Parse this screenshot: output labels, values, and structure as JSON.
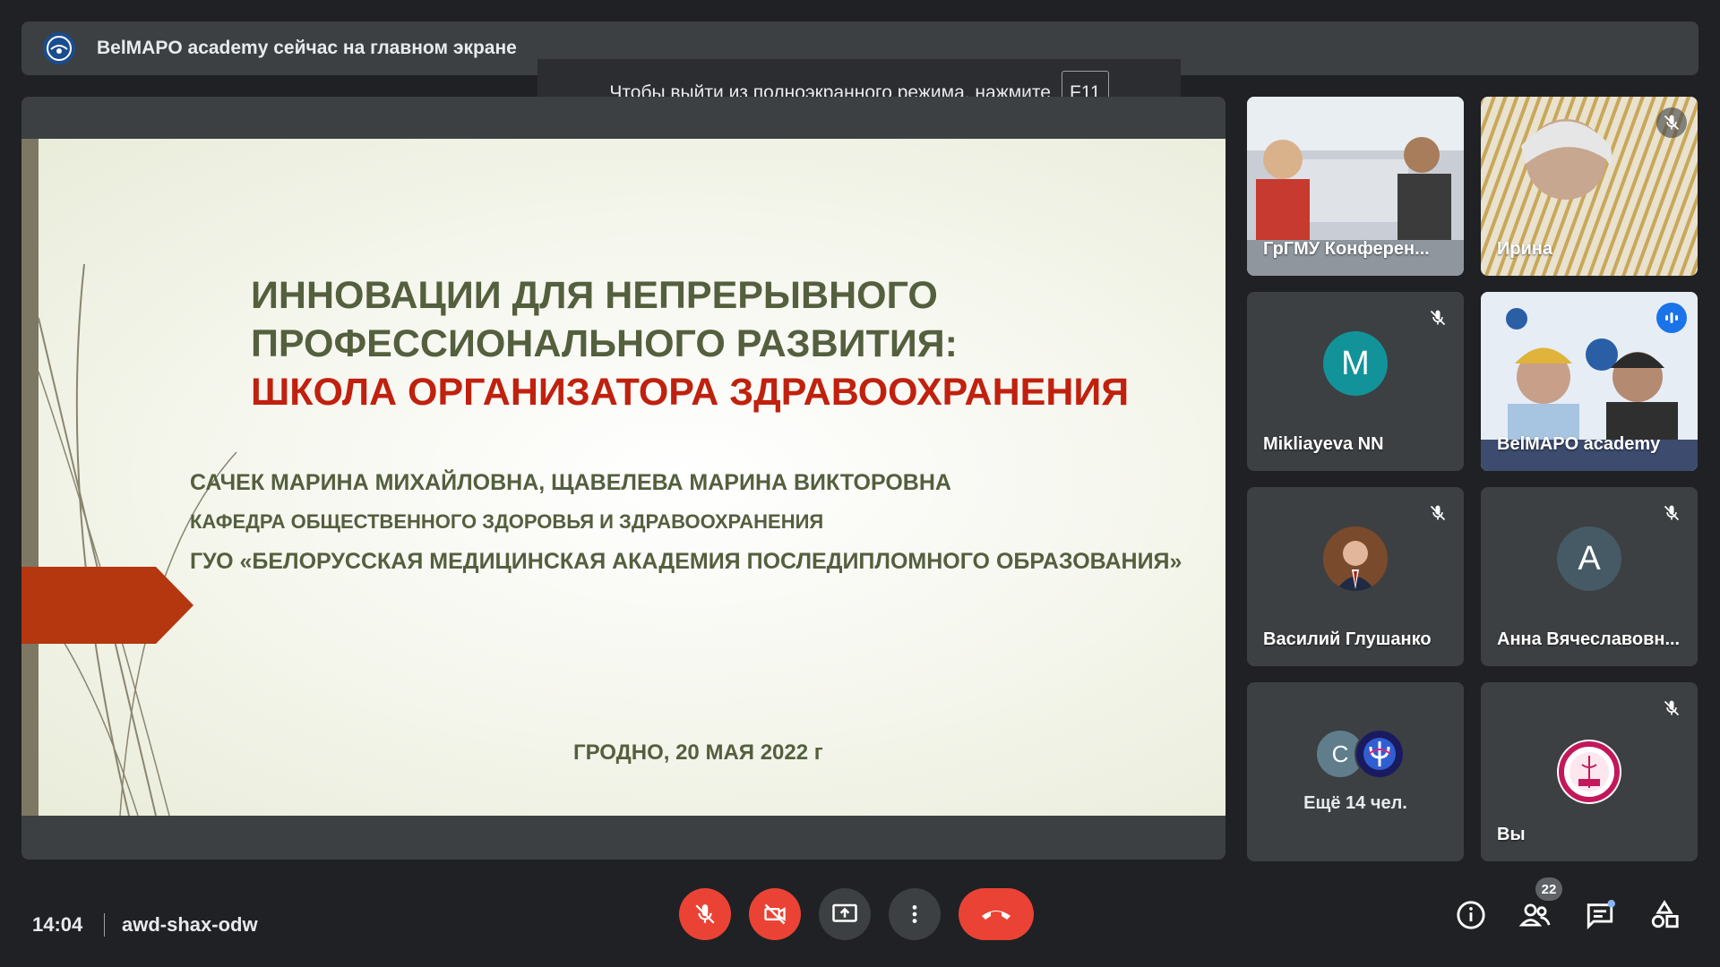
{
  "banner": {
    "text": "BelMAPO academy сейчас на главном экране",
    "logo_icon": "belmapo-logo-icon"
  },
  "fullscreen_hint": {
    "text": "Чтобы выйти из полноэкранного режима, нажмите",
    "key": "F11"
  },
  "slide": {
    "title_line1": "ИННОВАЦИИ ДЛЯ НЕПРЕРЫВНОГО",
    "title_line2": "ПРОФЕССИОНАЛЬНОГО РАЗВИТИЯ:",
    "title_line3": "ШКОЛА ОРГАНИЗАТОРА ЗДРАВООХРАНЕНИЯ",
    "authors": "САЧЕК МАРИНА МИХАЙЛОВНА,  ЩАВЕЛЕВА МАРИНА ВИКТОРОВНА",
    "department": "КАФЕДРА ОБЩЕСТВЕННОГО ЗДОРОВЬЯ И ЗДРАВООХРАНЕНИЯ",
    "institution": "ГУО «БЕЛОРУССКАЯ МЕДИЦИНСКАЯ АКАДЕМИЯ ПОСЛЕДИПЛОМНОГО ОБРАЗОВАНИЯ»",
    "date": "ГРОДНО, 20 МАЯ 2022 г",
    "colors": {
      "title": "#545f3e",
      "accent": "#c0210e",
      "arrow": "#b5370f"
    }
  },
  "participants": [
    {
      "name": "ГрГМУ Конферен...",
      "type": "video",
      "muted": false
    },
    {
      "name": "Ирина",
      "type": "video",
      "muted": true
    },
    {
      "name": "Mikliayeva NN",
      "type": "avatar",
      "initial": "M",
      "color": "#12939a",
      "muted": true
    },
    {
      "name": "BelMAPO academy",
      "type": "video",
      "speaking": true
    },
    {
      "name": "Василий Глушанко",
      "type": "photo",
      "muted": true
    },
    {
      "name": "Анна Вячеславовн...",
      "type": "avatar",
      "initial": "A",
      "color": "#455a64",
      "muted": true
    },
    {
      "name": "Ещё 14 чел.",
      "type": "more",
      "initial": "C"
    },
    {
      "name": "Вы",
      "type": "logo",
      "muted": true
    }
  ],
  "bottombar": {
    "time": "14:04",
    "meeting_code": "awd-shax-odw",
    "participant_count": "22",
    "icons": [
      "mic-off-icon",
      "camera-off-icon",
      "present-screen-icon",
      "more-options-icon",
      "end-call-icon",
      "info-icon",
      "people-icon",
      "chat-icon",
      "activities-icon"
    ]
  }
}
